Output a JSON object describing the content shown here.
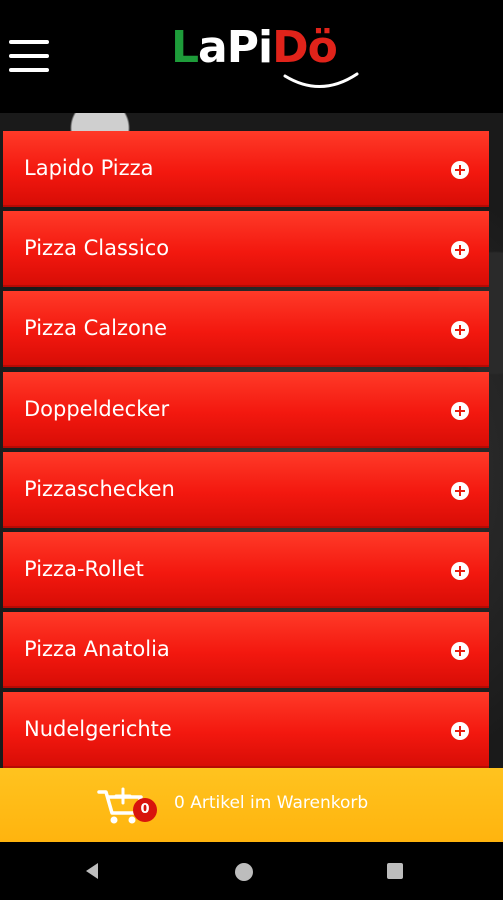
{
  "app": {
    "logo": "LaPiDö"
  },
  "categories": [
    {
      "label": "Lapido Pizza"
    },
    {
      "label": "Pizza Classico"
    },
    {
      "label": "Pizza Calzone"
    },
    {
      "label": "Doppeldecker"
    },
    {
      "label": "Pizzaschecken"
    },
    {
      "label": "Pizza-Rollet"
    },
    {
      "label": "Pizza Anatolia"
    },
    {
      "label": "Nudelgerichte"
    }
  ],
  "cart": {
    "count": "0",
    "label": "0 Artikel im Warenkorb"
  },
  "icons": {
    "menu": "hamburger-menu-icon",
    "expand": "plus-circle-icon",
    "cart": "cart-icon",
    "back": "back-triangle-icon",
    "home": "home-circle-icon",
    "recents": "recents-square-icon"
  },
  "colors": {
    "header_bg": "#000000",
    "category_red": "#f3180f",
    "cart_bar": "#ffb40e",
    "badge_red": "#d8140c",
    "logo_green": "#1e9c3a",
    "logo_red": "#e1231a"
  }
}
